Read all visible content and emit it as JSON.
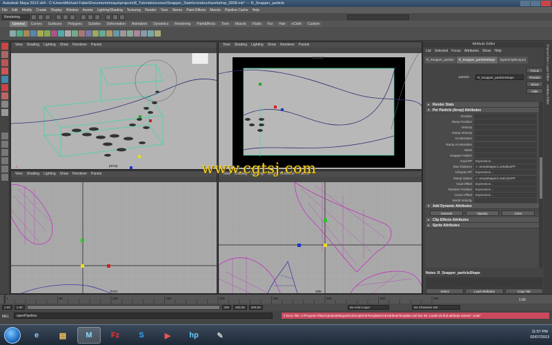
{
  "window": {
    "title": "Autodesk Maya 2013 x64 - C:\\Users\\Michael Fabio\\Documents\\maya\\projects\\8_Tutorials\\scenes\\Snapper_Swim\\construct\\workshop_0008.mb* --- R_Snapper_particle"
  },
  "menubar": [
    "File",
    "Edit",
    "Modify",
    "Create",
    "Display",
    "Window",
    "Assets",
    "Lighting/Shading",
    "Texturing",
    "Render",
    "Toon",
    "Stereo",
    "Paint Effects",
    "Muscle",
    "Pipeline Cache",
    "Help"
  ],
  "statusline": {
    "mode": "Rendering"
  },
  "shelf_tabs": [
    "General",
    "Curves",
    "Surfaces",
    "Polygons",
    "Subdivs",
    "Deformation",
    "Animation",
    "Dynamics",
    "Rendering",
    "PaintEffects",
    "Toon",
    "Muscle",
    "Fluids",
    "Fur",
    "Hair",
    "nCloth",
    "Custom"
  ],
  "viewport_menu": [
    "View",
    "Shading",
    "Lighting",
    "Show",
    "Renderer",
    "Panels"
  ],
  "viewports": {
    "persp": "persp",
    "front": "front",
    "side": "side",
    "camera_label": "FRONT"
  },
  "attribute_editor": {
    "title": "Attribute Editor",
    "menu": [
      "List",
      "Selected",
      "Focus",
      "Attributes",
      "Show",
      "Help"
    ],
    "tabs": [
      "R_Snapper_particle",
      "R_Snapper_particleShape",
      "hyperGraphLayout"
    ],
    "focus_buttons": [
      "Focus",
      "Presets",
      "Show",
      "Hide"
    ],
    "node_label": "particle:",
    "node_value": "R_Snapper_particleShape",
    "sections": {
      "render_stats": "Render Stats",
      "per_particle": "Per Particle (Array) Attributes",
      "add_dynamic": "Add Dynamic Attributes",
      "clip_effects": "Clip Effects Attributes",
      "sprite": "Sprite Attributes"
    },
    "attributes": [
      {
        "name": "Position",
        "value": ""
      },
      {
        "name": "Ramp Position",
        "value": ""
      },
      {
        "name": "Velocity",
        "value": ""
      },
      {
        "name": "Ramp Velocity",
        "value": ""
      },
      {
        "name": "Acceleration",
        "value": ""
      },
      {
        "name": "Ramp Acceleration",
        "value": ""
      },
      {
        "name": "Mass",
        "value": ""
      },
      {
        "name": "Snapper INDEX",
        "value": ""
      },
      {
        "name": "Goal PP",
        "value": "Expression..."
      },
      {
        "name": "Max Distance",
        "value": "<- arrayMapper1.outValuePP"
      },
      {
        "name": "Lifespan PP",
        "value": "Expression..."
      },
      {
        "name": "Ramp Values",
        "value": "<- arrayMapper2.outColorPP"
      },
      {
        "name": "Goal Offset",
        "value": "Expression..."
      },
      {
        "name": "Random Position",
        "value": "Expression..."
      },
      {
        "name": "Curve Offset",
        "value": "Expression..."
      },
      {
        "name": "World Velocity",
        "value": ""
      }
    ],
    "dynamic_buttons": [
      "General",
      "Opacity",
      "Color"
    ],
    "notes_label": "Notes: R_Snapper_particleShape",
    "bottom_buttons": [
      "Select",
      "Load Attributes",
      "Copy Tab"
    ]
  },
  "sidebar_tabs": [
    "Channel Box / Layer Editor",
    "Attribute Editor"
  ],
  "timeslider": {
    "ticks": [
      "1",
      "50",
      "100",
      "150",
      "200",
      "250",
      "300",
      "350",
      "400"
    ],
    "current": "1.00"
  },
  "rangeslider": {
    "start": "1.00",
    "inner_start": "1.00",
    "inner_end": "400",
    "end": "400.00",
    "end2": "400.00",
    "anim_layer": "No Anim Layer",
    "char_set": "No Character Set"
  },
  "cmdline": {
    "label": "MEL",
    "input": "openPipeline;",
    "error": "// Error: file: C:/Program Files/Autodesk/Maya2013/scripts/AETemplates/AEAttributeTemplate.mel line 45: Could not find attribute named \".ucds\""
  },
  "taskbar": {
    "time": "11:57 PM",
    "date": "02/07/2013"
  },
  "watermark": "www.cgtsj.com",
  "colors": {
    "accent_error": "#c94a5e",
    "watermark": "#f4d020"
  }
}
